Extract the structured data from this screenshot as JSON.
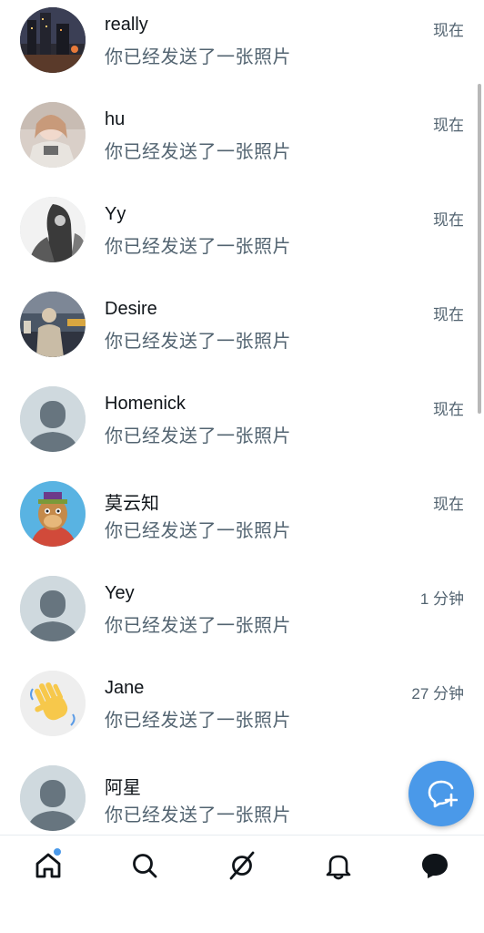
{
  "conversations": [
    {
      "name": "really",
      "preview": "你已经发送了一张照片",
      "time": "现在",
      "avatar": "photo-city-night"
    },
    {
      "name": "hu",
      "preview": "你已经发送了一张照片",
      "time": "现在",
      "avatar": "photo-person"
    },
    {
      "name": "Yy",
      "preview": "你已经发送了一张照片",
      "time": "现在",
      "avatar": "photo-monochrome"
    },
    {
      "name": "Desire",
      "preview": "你已经发送了一张照片",
      "time": "现在",
      "avatar": "photo-street"
    },
    {
      "name": "Homenick",
      "preview": "你已经发送了一张照片",
      "time": "现在",
      "avatar": "default-avatar"
    },
    {
      "name": "莫云知",
      "preview": "你已经发送了一张照片",
      "time": "现在",
      "avatar": "cartoon-ape"
    },
    {
      "name": "Yey",
      "preview": "你已经发送了一张照片",
      "time": "1 分钟",
      "avatar": "default-avatar"
    },
    {
      "name": "Jane",
      "preview": "你已经发送了一张照片",
      "time": "27 分钟",
      "avatar": "waving-hand-emoji"
    },
    {
      "name": "阿星",
      "preview": "你已经发送了一张照片",
      "time": "",
      "avatar": "default-avatar"
    }
  ],
  "fab": {
    "icon": "new-message-icon",
    "color": "#4a99e9"
  },
  "nav": {
    "items": [
      {
        "icon": "home-icon",
        "active_dot": true
      },
      {
        "icon": "search-icon"
      },
      {
        "icon": "spaces-icon"
      },
      {
        "icon": "notifications-icon"
      },
      {
        "icon": "messages-icon",
        "selected": true
      }
    ]
  },
  "colors": {
    "accent": "#4a99e9",
    "text_primary": "#0f1419",
    "text_secondary": "#536471"
  }
}
